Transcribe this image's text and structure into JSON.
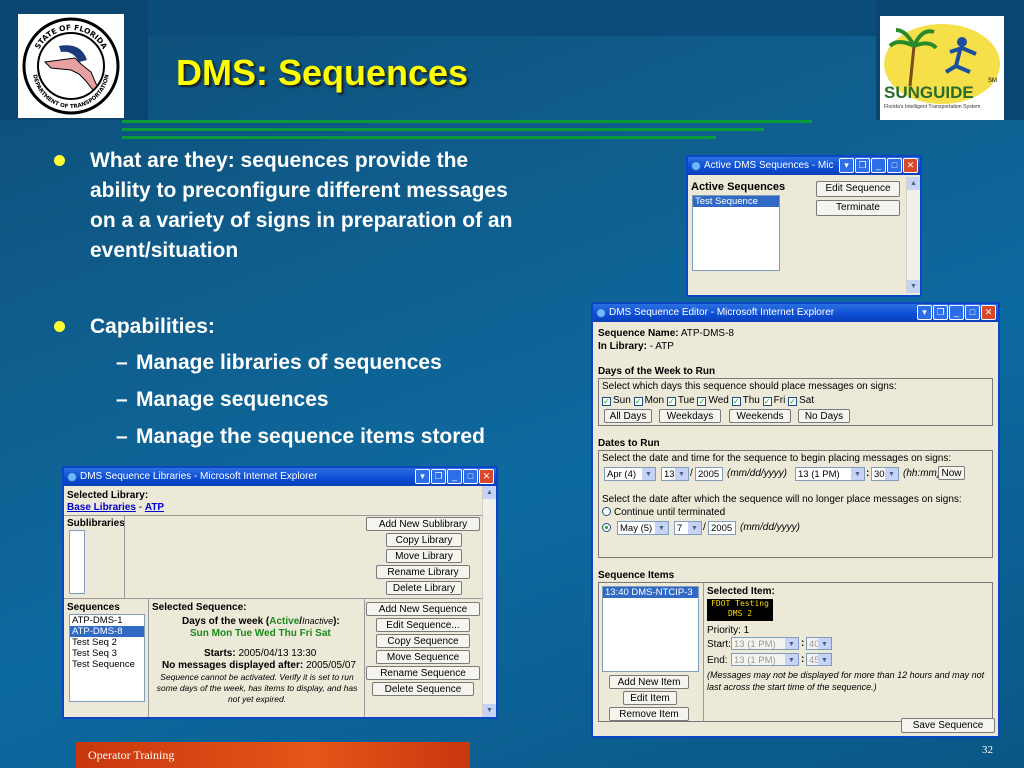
{
  "slide": {
    "title": "DMS: Sequences",
    "footer": "Operator Training",
    "page_number": "32"
  },
  "logos": {
    "fdot_text_top": "STATE OF FLORIDA",
    "fdot_text_bottom": "DEPARTMENT OF TRANSPORTATION",
    "sunguide_name": "SUNGUIDE",
    "sunguide_mark": "SM",
    "sunguide_tagline": "Florida's Intelligent Transportation System"
  },
  "bullets": {
    "b1_lines": [
      "What are they: sequences provide the",
      "ability to preconfigure different messages",
      "on a a variety of signs in preparation of an",
      "event/situation"
    ],
    "b2": "Capabilities:",
    "dash": "–",
    "subs": [
      "Manage libraries of sequences",
      "Manage sequences",
      "Manage the sequence items stored"
    ]
  },
  "active_window": {
    "title": "Active DMS Sequences - Mic",
    "heading": "Active Sequences",
    "items": [
      "Test Sequence"
    ],
    "edit_button": "Edit Sequence",
    "terminate_button": "Terminate"
  },
  "editor_window": {
    "title": "DMS Sequence Editor - Microsoft Internet Explorer",
    "seq_name_label": "Sequence Name:",
    "seq_name_value": "ATP-DMS-8",
    "library_label": "In Library:",
    "library_value": "- ATP",
    "days_heading": "Days of the Week to Run",
    "days_prompt": "Select which days this sequence should place messages on signs:",
    "days": [
      "Sun",
      "Mon",
      "Tue",
      "Wed",
      "Thu",
      "Fri",
      "Sat"
    ],
    "day_buttons": [
      "All Days",
      "Weekdays",
      "Weekends",
      "No Days"
    ],
    "dates_heading": "Dates to Run",
    "start_prompt": "Select the date and time for the sequence to begin placing messages on signs:",
    "start_month": "Apr (4)",
    "start_day": "13",
    "start_year": "2005",
    "date_fmt": "(mm/dd/yyyy)",
    "start_hour": "13 (1 PM)",
    "start_min": "30",
    "time_fmt": "(hh:mm)",
    "now_button": "Now",
    "end_prompt": "Select the date after which the sequence will no longer place messages on signs:",
    "continue_label": "Continue until terminated",
    "end_month": "May (5)",
    "end_day": "7",
    "end_year": "2005",
    "slash": "/",
    "colon": ":",
    "items_heading": "Sequence Items",
    "items": [
      "13:40 DMS-NTCIP-3"
    ],
    "selected_item_label": "Selected Item:",
    "sign_line1": "FDOT Testing",
    "sign_line2": "DMS 2",
    "priority": "Priority: 1",
    "start_label": "Start:",
    "end_label": "End:",
    "item_start_hour": "13 (1 PM)",
    "item_start_min": "40",
    "item_end_hour": "13 (1 PM)",
    "item_end_min": "45",
    "note": "(Messages may not be displayed for more than 12 hours and may not last across the start time of the sequence.)",
    "add_item": "Add New Item",
    "edit_item": "Edit Item",
    "remove_item": "Remove Item",
    "save": "Save Sequence"
  },
  "library_window": {
    "title": "DMS Sequence Libraries - Microsoft Internet Explorer",
    "selected_library_label": "Selected Library:",
    "base_link": "Base Libraries",
    "separator": "-",
    "atp_link": "ATP",
    "sublibraries_label": "Sublibraries",
    "lib_buttons": [
      "Add New Sublibrary",
      "Copy Library",
      "Move Library",
      "Rename Library",
      "Delete Library"
    ],
    "sequences_label": "Sequences",
    "sequences": [
      "ATP-DMS-1",
      "ATP-DMS-8",
      "Test Seq 2",
      "Test Seq 3",
      "Test Sequence"
    ],
    "selected_sequence_label": "Selected Sequence:",
    "days_of_week_prefix": "Days of the week (",
    "active_word": "Active",
    "inactive_word": "Inactive",
    "days_suffix": "):",
    "days_value": "Sun Mon Tue Wed Thu Fri Sat",
    "starts_label": "Starts:",
    "starts_value": "2005/04/13 13:30",
    "nomsg_label": "No messages displayed after:",
    "nomsg_value": "2005/05/07",
    "warning": "Sequence cannot be activated. Verify it is set to run some days of the week, has items to display, and has not yet expired.",
    "seq_buttons": [
      "Add New Sequence",
      "Edit Sequence...",
      "Copy Sequence",
      "Move Sequence",
      "Rename Sequence",
      "Delete Sequence"
    ]
  },
  "colors": {
    "title": "#ffff00",
    "bullet": "#ffff33",
    "xp_title": "#0b4cd3",
    "footer": "#d9480f"
  }
}
